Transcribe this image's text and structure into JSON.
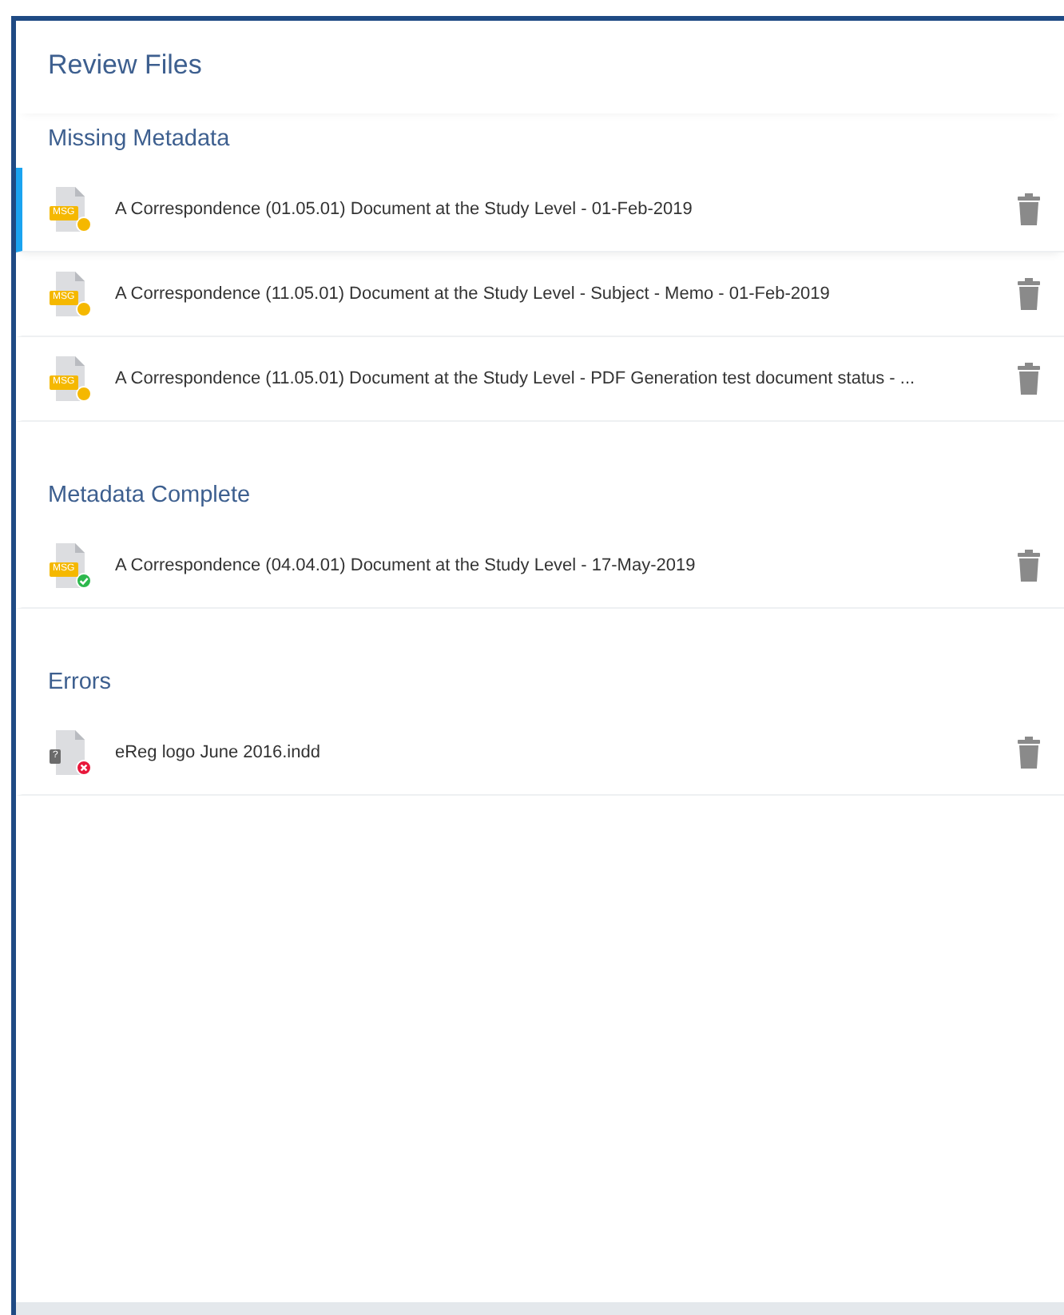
{
  "title": "Review Files",
  "sections": [
    {
      "heading": "Missing Metadata",
      "files": [
        {
          "name": "A Correspondence (01.05.01) Document at the Study Level - 01-Feb-2019",
          "type_label": "MSG",
          "kind": "pending",
          "selected": true
        },
        {
          "name": "A Correspondence (11.05.01) Document at the Study Level - Subject - Memo - 01-Feb-2019",
          "type_label": "MSG",
          "kind": "pending",
          "selected": false
        },
        {
          "name": "A Correspondence (11.05.01) Document at the Study Level - PDF Generation test document status - ...",
          "type_label": "MSG",
          "kind": "pending",
          "selected": false
        }
      ]
    },
    {
      "heading": "Metadata Complete",
      "files": [
        {
          "name": "A Correspondence (04.04.01) Document at the Study Level - 17-May-2019",
          "type_label": "MSG",
          "kind": "complete",
          "selected": false
        }
      ]
    },
    {
      "heading": "Errors",
      "files": [
        {
          "name": "eReg logo June 2016.indd",
          "type_label": "?",
          "kind": "error",
          "selected": false
        }
      ]
    }
  ]
}
